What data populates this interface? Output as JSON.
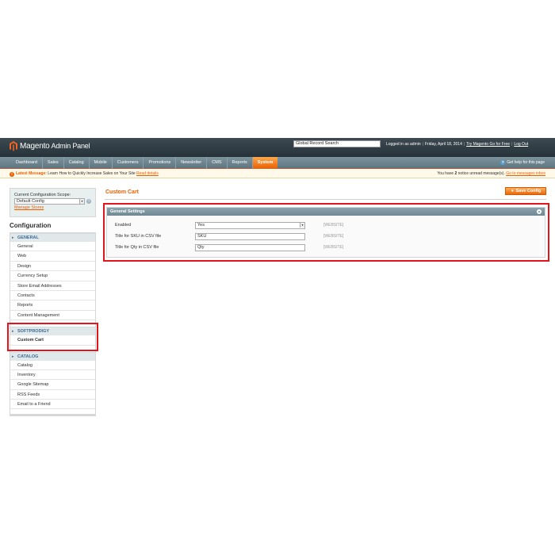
{
  "header": {
    "logo_brand": "Magento",
    "logo_sub": "Admin Panel",
    "search_value": "Global Record Search",
    "logged_in": "Logged in as admin",
    "date": "Friday, April 18, 2014",
    "try_link": "Try Magento Go for Free",
    "logout": "Log Out"
  },
  "nav": {
    "items": [
      "Dashboard",
      "Sales",
      "Catalog",
      "Mobile",
      "Customers",
      "Promotions",
      "Newsletter",
      "CMS",
      "Reports",
      "System"
    ],
    "active": "System",
    "help": "Get help for this page"
  },
  "notice": {
    "prefix": "Latest Message:",
    "text": "Learn How to Quickly Increase Sales on Your Site",
    "read_details": "Read details",
    "right_pre": "You have",
    "right_count": "2",
    "right_mid": "notice unread message(s).",
    "right_link": "Go to messages inbox"
  },
  "sidebar": {
    "scope_label": "Current Configuration Scope:",
    "scope_value": "Default Config",
    "manage_stores": "Manage Stores",
    "title": "Configuration",
    "groups": [
      {
        "name": "GENERAL",
        "items": [
          "General",
          "Web",
          "Design",
          "Currency Setup",
          "Store Email Addresses",
          "Contacts",
          "Reports",
          "Content Management"
        ]
      },
      {
        "name": "SOFTPRODIGY",
        "items": [
          "Custom Cart"
        ]
      },
      {
        "name": "CATALOG",
        "items": [
          "Catalog",
          "Inventory",
          "Google Sitemap",
          "RSS Feeds",
          "Email to a Friend"
        ]
      }
    ]
  },
  "main": {
    "title": "Custom Cart",
    "save_label": "Save Config",
    "section_title": "General Settings",
    "fields": [
      {
        "label": "Enabled",
        "value": "Yes",
        "scope": "[WEBSITE]"
      },
      {
        "label": "Title for SKU in CSV file",
        "value": "SKU",
        "scope": "[WEBSITE]"
      },
      {
        "label": "Title for Qty in CSV file",
        "value": "Qty",
        "scope": "[WEBSITE]"
      }
    ]
  },
  "colors": {
    "accent": "#eb5e00",
    "header_bg": "#26333a",
    "nav_bg": "#6f8893",
    "highlight": "#e3141c"
  },
  "icons": [
    "magento-logo-icon",
    "help-icon",
    "warning-icon",
    "collapse-icon",
    "dropdown-arrow-icon",
    "save-icon"
  ]
}
